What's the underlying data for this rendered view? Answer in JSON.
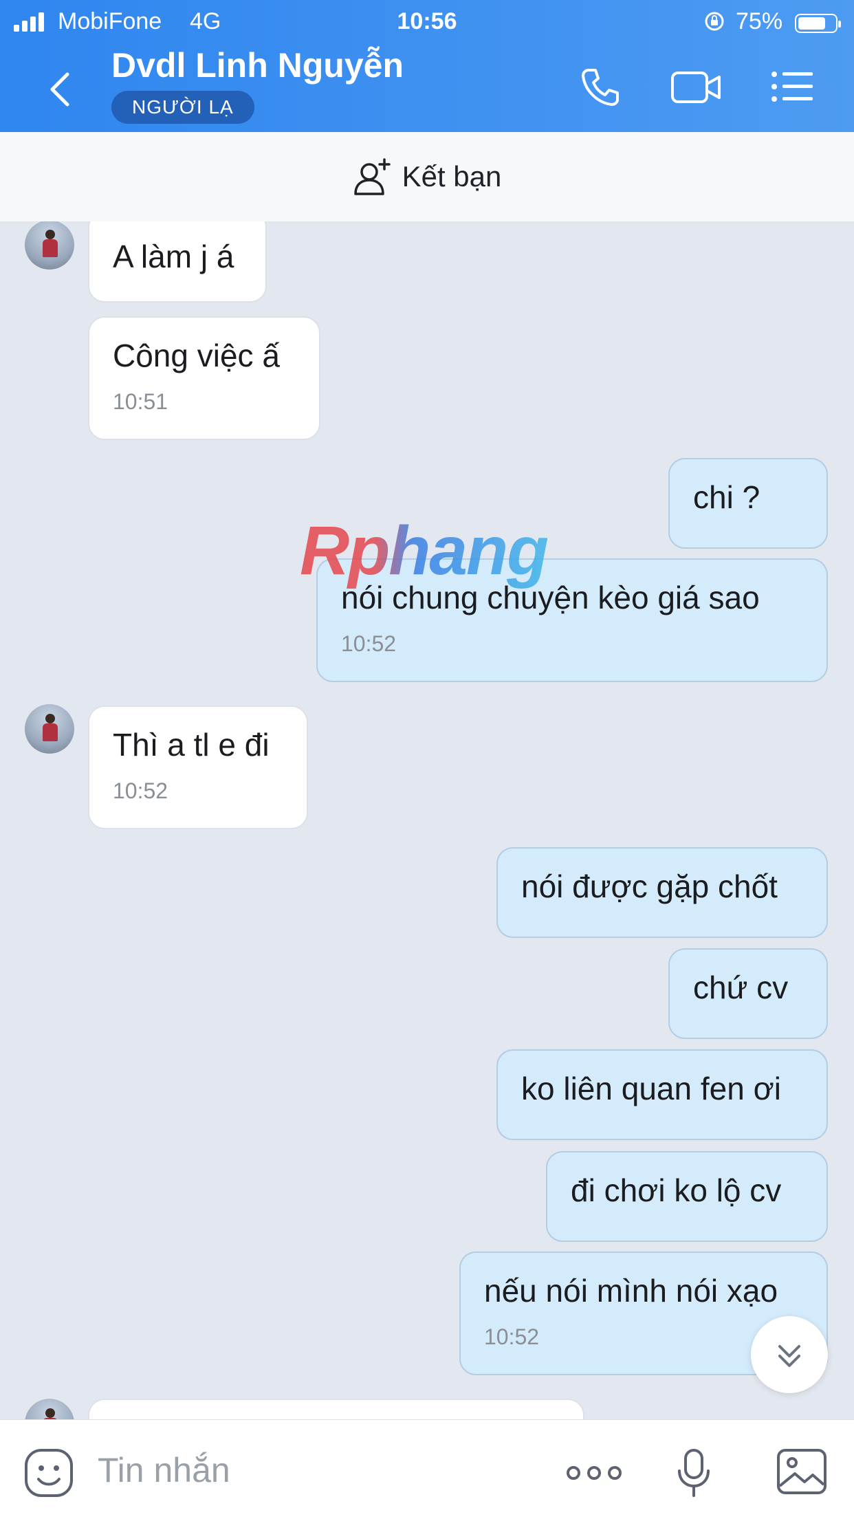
{
  "status_bar": {
    "carrier": "MobiFone",
    "network": "4G",
    "time": "10:56",
    "battery": "75%",
    "battery_level": 0.75
  },
  "header": {
    "contact_name": "Dvdl Linh Nguyễn",
    "badge": "NGƯỜI LẠ",
    "icons": [
      "back-icon",
      "phone-icon",
      "video-call-icon",
      "menu-icon"
    ]
  },
  "add_friend": {
    "label": "Kết bạn",
    "icon": "add-user-icon"
  },
  "messages": [
    {
      "side": "in",
      "text": "A làm j á",
      "time": ""
    },
    {
      "side": "in",
      "text": "Công việc ấ",
      "time": "10:51"
    },
    {
      "side": "out",
      "text": "chi ?",
      "time": ""
    },
    {
      "side": "out",
      "text": "nói chung chuyện kèo giá sao",
      "time": "10:52"
    },
    {
      "side": "in",
      "text": "Thì a tl e đi",
      "time": "10:52"
    },
    {
      "side": "out",
      "text": "nói được gặp chốt",
      "time": ""
    },
    {
      "side": "out",
      "text": "chứ cv",
      "time": ""
    },
    {
      "side": "out",
      "text": "ko liên quan fen ơi",
      "time": ""
    },
    {
      "side": "out",
      "text": "đi chơi ko lộ cv",
      "time": ""
    },
    {
      "side": "out",
      "text": "nếu nói mình nói xạo",
      "time": "10:52"
    }
  ],
  "watermark": "Rphang",
  "input_bar": {
    "placeholder": "Tin nhắn",
    "icons": [
      "sticker-icon",
      "more-icon",
      "microphone-icon",
      "image-icon"
    ]
  }
}
